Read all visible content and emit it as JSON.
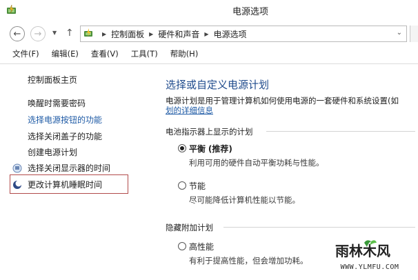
{
  "window": {
    "title": "电源选项"
  },
  "address": {
    "crumbs": [
      "控制面板",
      "硬件和声音",
      "电源选项"
    ]
  },
  "menu": [
    {
      "label": "文件(F)"
    },
    {
      "label": "编辑(E)"
    },
    {
      "label": "查看(V)"
    },
    {
      "label": "工具(T)"
    },
    {
      "label": "帮助(H)"
    }
  ],
  "sidebar": {
    "home": "控制面板主页",
    "items": [
      {
        "label": "唤醒时需要密码"
      },
      {
        "label": "选择电源按钮的功能"
      },
      {
        "label": "选择关闭盖子的功能"
      },
      {
        "label": "创建电源计划"
      },
      {
        "label": "选择关闭显示器的时间"
      },
      {
        "label": "更改计算机睡眠时间"
      }
    ]
  },
  "main": {
    "title": "选择或自定义电源计划",
    "description": "电源计划是用于管理计算机如何使用电源的一套硬件和系统设置(如",
    "description_link": "划的详细信息",
    "section_battery": "电池指示器上显示的计划",
    "plans": [
      {
        "name": "平衡",
        "tag": "(推荐)",
        "desc": "利用可用的硬件自动平衡功耗与性能。",
        "checked": true
      },
      {
        "name": "节能",
        "tag": "",
        "desc": "尽可能降低计算机性能以节能。",
        "checked": false
      }
    ],
    "section_hidden": "隐藏附加计划",
    "hidden_plans": [
      {
        "name": "高性能",
        "desc": "有利于提高性能，但会增加功耗。",
        "checked": false
      }
    ]
  },
  "watermark": {
    "logo_text": "雨林木风",
    "url": "WWW.YLMFU.COM"
  },
  "colors": {
    "link": "#1e5aa5",
    "title": "#1e4a8c",
    "highlight_border": "#b14a4a"
  }
}
